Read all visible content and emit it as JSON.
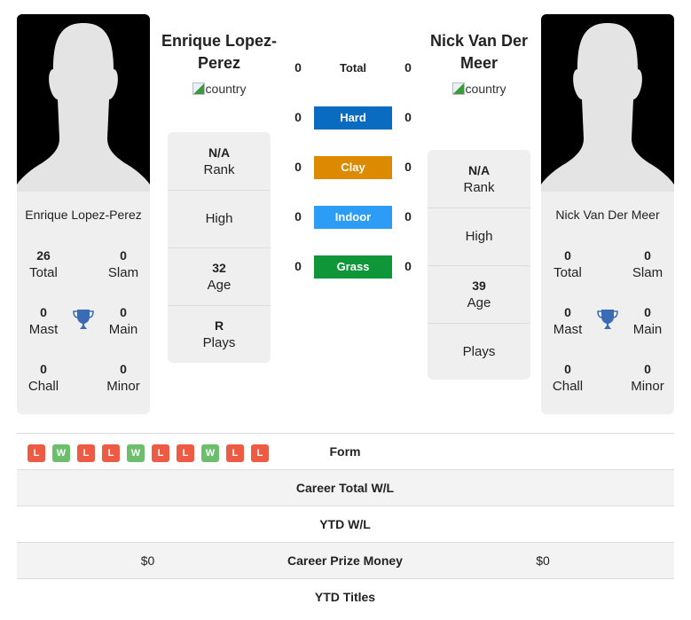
{
  "player1": {
    "name": "Enrique Lopez-Perez",
    "country_alt": "country",
    "titles": {
      "total": {
        "value": "26",
        "label": "Total"
      },
      "slam": {
        "value": "0",
        "label": "Slam"
      },
      "mast": {
        "value": "0",
        "label": "Mast"
      },
      "main": {
        "value": "0",
        "label": "Main"
      },
      "chall": {
        "value": "0",
        "label": "Chall"
      },
      "minor": {
        "value": "0",
        "label": "Minor"
      }
    },
    "info": {
      "rank": {
        "value": "N/A",
        "label": "Rank"
      },
      "high": {
        "value": "",
        "label": "High"
      },
      "age": {
        "value": "32",
        "label": "Age"
      },
      "plays": {
        "value": "R",
        "label": "Plays"
      }
    }
  },
  "player2": {
    "name": "Nick Van Der Meer",
    "country_alt": "country",
    "titles": {
      "total": {
        "value": "0",
        "label": "Total"
      },
      "slam": {
        "value": "0",
        "label": "Slam"
      },
      "mast": {
        "value": "0",
        "label": "Mast"
      },
      "main": {
        "value": "0",
        "label": "Main"
      },
      "chall": {
        "value": "0",
        "label": "Chall"
      },
      "minor": {
        "value": "0",
        "label": "Minor"
      }
    },
    "info": {
      "rank": {
        "value": "N/A",
        "label": "Rank"
      },
      "high": {
        "value": "",
        "label": "High"
      },
      "age": {
        "value": "39",
        "label": "Age"
      },
      "plays": {
        "value": "",
        "label": "Plays"
      }
    }
  },
  "h2h": [
    {
      "label": "Total",
      "left": "0",
      "right": "0",
      "color": ""
    },
    {
      "label": "Hard",
      "left": "0",
      "right": "0",
      "color": "#0a6cc0"
    },
    {
      "label": "Clay",
      "left": "0",
      "right": "0",
      "color": "#dc8b00"
    },
    {
      "label": "Indoor",
      "left": "0",
      "right": "0",
      "color": "#2d9cf5"
    },
    {
      "label": "Grass",
      "left": "0",
      "right": "0",
      "color": "#0e9638"
    }
  ],
  "form": [
    "L",
    "W",
    "L",
    "L",
    "W",
    "L",
    "L",
    "W",
    "L",
    "L"
  ],
  "table": {
    "form_label": "Form",
    "rows": [
      {
        "label": "Career Total W/L",
        "left": "",
        "right": ""
      },
      {
        "label": "YTD W/L",
        "left": "",
        "right": ""
      },
      {
        "label": "Career Prize Money",
        "left": "$0",
        "right": "$0"
      },
      {
        "label": "YTD Titles",
        "left": "",
        "right": ""
      }
    ]
  }
}
